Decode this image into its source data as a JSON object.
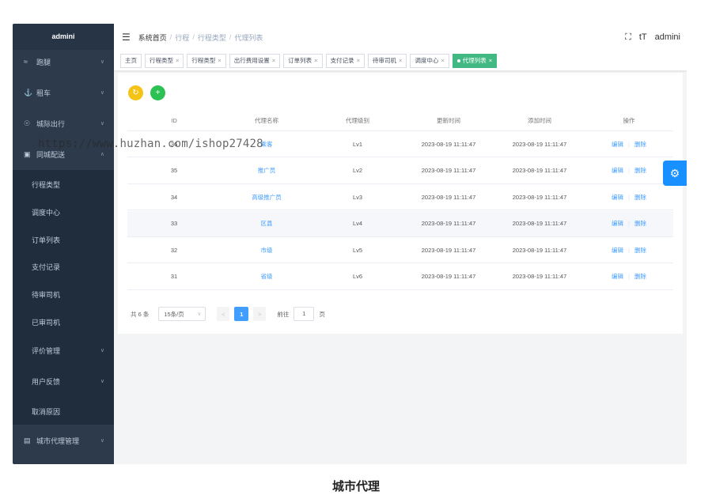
{
  "app": {
    "title": "admini",
    "user": "admini"
  },
  "sidebar": {
    "items": [
      {
        "icon": "run-icon",
        "glyph": "≈",
        "label": "跑腿"
      },
      {
        "icon": "car-icon",
        "glyph": "⚓",
        "label": "租车"
      },
      {
        "icon": "location-icon",
        "glyph": "☉",
        "label": "城际出行"
      },
      {
        "icon": "truck-icon",
        "glyph": "▣",
        "label": "同城配送"
      }
    ],
    "subitems": [
      "行程类型",
      "调度中心",
      "订单列表",
      "支付记录",
      "待审司机",
      "已审司机"
    ],
    "nested": [
      "评价管理",
      "用户反馈",
      "取消原因"
    ],
    "bottom": {
      "icon": "clipboard-icon",
      "glyph": "▤",
      "label": "城市代理管理"
    }
  },
  "header": {
    "breadcrumb": [
      "系统首页",
      "行程",
      "行程类型",
      "代理列表"
    ],
    "fullscreen_glyph": "⛶",
    "fontsize_glyph": "tT"
  },
  "tags": [
    {
      "label": "主页",
      "closable": false,
      "active": false
    },
    {
      "label": "行程类型",
      "closable": true,
      "active": false
    },
    {
      "label": "行程类型",
      "closable": true,
      "active": false
    },
    {
      "label": "出行费用设置",
      "closable": true,
      "active": false
    },
    {
      "label": "订单列表",
      "closable": true,
      "active": false
    },
    {
      "label": "支付记录",
      "closable": true,
      "active": false
    },
    {
      "label": "待审司机",
      "closable": true,
      "active": false
    },
    {
      "label": "调度中心",
      "closable": true,
      "active": false
    },
    {
      "label": "代理列表",
      "closable": true,
      "active": true
    }
  ],
  "actions": {
    "refresh_glyph": "↻",
    "add_glyph": "+"
  },
  "table": {
    "headers": [
      "ID",
      "代理名称",
      "代理级别",
      "更新时间",
      "添加时间",
      "操作"
    ],
    "rows": [
      {
        "id": "36",
        "name": "乘客",
        "level": "Lv1",
        "updated": "2023-08-19 11:11:47",
        "added": "2023-08-19 11:11:47"
      },
      {
        "id": "35",
        "name": "推广员",
        "level": "Lv2",
        "updated": "2023-08-19 11:11:47",
        "added": "2023-08-19 11:11:47"
      },
      {
        "id": "34",
        "name": "高级推广员",
        "level": "Lv3",
        "updated": "2023-08-19 11:11:47",
        "added": "2023-08-19 11:11:47"
      },
      {
        "id": "33",
        "name": "区县",
        "level": "Lv4",
        "updated": "2023-08-19 11:11:47",
        "added": "2023-08-19 11:11:47"
      },
      {
        "id": "32",
        "name": "市级",
        "level": "Lv5",
        "updated": "2023-08-19 11:11:47",
        "added": "2023-08-19 11:11:47"
      },
      {
        "id": "31",
        "name": "省级",
        "level": "Lv6",
        "updated": "2023-08-19 11:11:47",
        "added": "2023-08-19 11:11:47"
      }
    ],
    "edit_label": "编辑",
    "delete_label": "删除"
  },
  "pagination": {
    "total_text": "共 6 条",
    "page_size": "15条/页",
    "prev_glyph": "<",
    "next_glyph": ">",
    "current_page": "1",
    "goto_prefix": "前往",
    "goto_value": "1",
    "goto_suffix": "页"
  },
  "float_settings_glyph": "⚙",
  "watermark": "https://www.huzhan.com/ishop27428",
  "caption": "城市代理",
  "colors": {
    "sidebar": "#2d3a4b",
    "submenu": "#1f2d3d",
    "active_tag": "#42b983",
    "primary": "#409eff",
    "warning": "#f5c316",
    "success": "#2bc253"
  }
}
